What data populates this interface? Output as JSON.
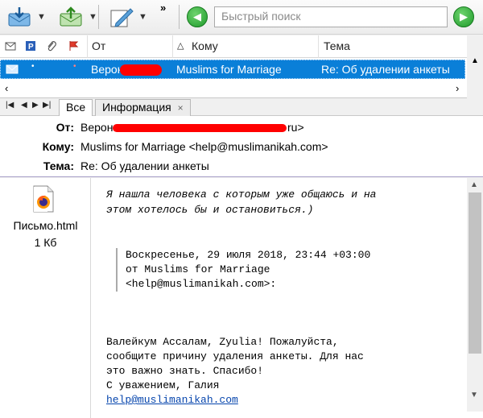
{
  "toolbar": {
    "more_label": "»",
    "search_placeholder": "Быстрый поиск"
  },
  "list": {
    "columns": {
      "from": "От",
      "to": "Кому",
      "subject": "Тема"
    },
    "selected": {
      "from": "Верон",
      "to": "Muslims for Marriage",
      "subject": "Re: Об удалении анкеты"
    }
  },
  "tabs": [
    {
      "label": "Все"
    },
    {
      "label": "Информация"
    }
  ],
  "tab_close": "×",
  "headers": {
    "from_label": "От:",
    "from_value": "Верон",
    "from_suffix": "ru>",
    "to_label": "Кому:",
    "to_value": "Muslims for Marriage <help@muslimanikah.com>",
    "subject_label": "Тема:",
    "subject_value": "Re: Об удалении анкеты"
  },
  "attachment": {
    "name": "Письмо.html",
    "size": "1 Кб"
  },
  "message": {
    "line1": "Я нашла человека с которым уже общаюсь и на",
    "line2": "этом хотелось бы и остановиться.)",
    "quote1": "Воскресенье, 29 июля 2018, 23:44 +03:00",
    "quote2": "от Muslims for Marriage",
    "quote3": "<help@muslimanikah.com>:",
    "reply1": "Валейкум Ассалам, Zyulia! Пожалуйста,",
    "reply2": "сообщите причину удаления анкеты. Для нас",
    "reply3": "это важно знать. Спасибо!",
    "reply4": "С уважением, Галия",
    "link": "help@muslimanikah.com"
  },
  "colors": {
    "accent": "#0a7fd8",
    "go_green": "#1e9a2a",
    "redaction": "#ff0000"
  }
}
